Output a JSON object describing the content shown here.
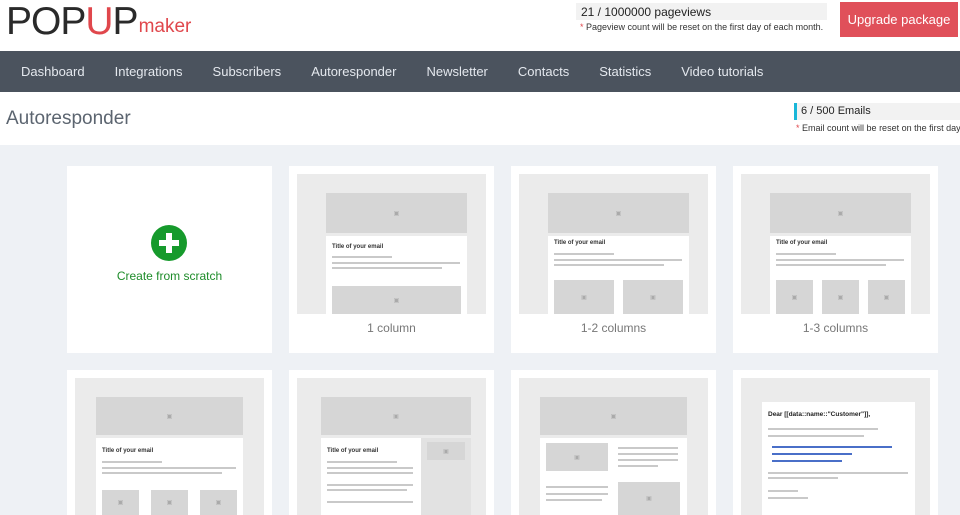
{
  "brand": {
    "logo_pre": "POP",
    "logo_red": "U",
    "logo_mid": "P",
    "logo_suffix": "maker",
    "accent": "#e0474c"
  },
  "usage": {
    "pageviews": "21 / 1000000 pageviews",
    "pageviews_star": "*",
    "pageviews_note": "Pageview count will be reset on the first day of each month.",
    "emails": "6 / 500 Emails",
    "emails_star": "*",
    "emails_note": "Email count will be reset on the first day of"
  },
  "upgrade_label": "Upgrade package",
  "nav": [
    "Dashboard",
    "Integrations",
    "Subscribers",
    "Autoresponder",
    "Newsletter",
    "Contacts",
    "Statistics",
    "Video tutorials"
  ],
  "page_title": "Autoresponder",
  "templates": {
    "scratch": "Create from scratch",
    "t1": "1 column",
    "t2": "1-2 columns",
    "t3": "1-3 columns"
  },
  "preview_text": {
    "title": "Title of your email",
    "dear": "Dear [[data::name::\"Customer\"]],"
  }
}
